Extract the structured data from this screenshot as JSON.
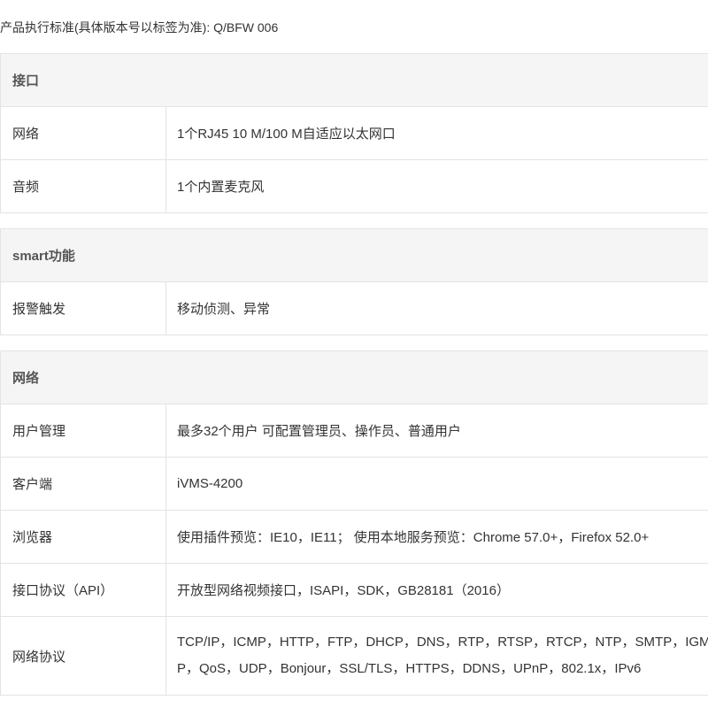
{
  "standard_line": "产品执行标准(具体版本号以标签为准): Q/BFW 006",
  "sections": [
    {
      "title": "接口",
      "rows": [
        {
          "label": "网络",
          "value": "1个RJ45 10 M/100 M自适应以太网口"
        },
        {
          "label": "音频",
          "value": "1个内置麦克风"
        }
      ]
    },
    {
      "title": "smart功能",
      "rows": [
        {
          "label": "报警触发",
          "value": "移动侦测、异常"
        }
      ]
    },
    {
      "title": "网络",
      "rows": [
        {
          "label": "用户管理",
          "value": "最多32个用户 可配置管理员、操作员、普通用户"
        },
        {
          "label": "客户端",
          "value": "iVMS-4200"
        },
        {
          "label": "浏览器",
          "value": "使用插件预览：IE10，IE11； 使用本地服务预览：Chrome 57.0+，Firefox 52.0+"
        },
        {
          "label": "接口协议（API）",
          "value": "开放型网络视频接口，ISAPI，SDK，GB28181（2016）"
        },
        {
          "label": "网络协议",
          "value": "TCP/IP，ICMP，HTTP，FTP，DHCP，DNS，RTP，RTSP，RTCP，NTP，SMTP，IGMP，QoS，UDP，Bonjour，SSL/TLS，HTTPS，DDNS，UPnP，802.1x，IPv6"
        }
      ]
    }
  ]
}
